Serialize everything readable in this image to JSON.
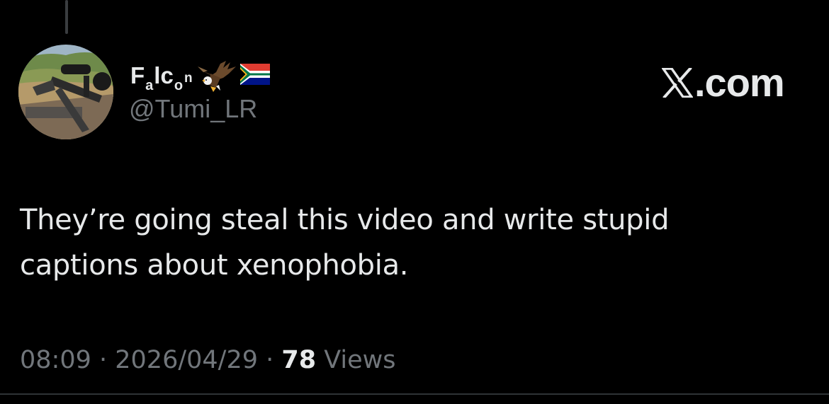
{
  "author": {
    "display_name": {
      "F": "F",
      "a": "a",
      "l": "l",
      "c": "c",
      "o": "o",
      "n": "n"
    },
    "name_emojis": [
      "eagle-icon",
      "south-africa-flag-icon"
    ],
    "handle": "@Tumi_LR",
    "avatar": "avatar-rifle-scope-landscape"
  },
  "brand": {
    "icon": "x-logo-icon",
    "label": ".com"
  },
  "tweet": {
    "text": "They’re going steal this video and write stupid\ncaptions about xenophobia."
  },
  "meta": {
    "time": "08:09",
    "separator": " · ",
    "date": "2026/04/29",
    "views_count": "78",
    "views_label": " Views"
  },
  "colors": {
    "background": "#000000",
    "primary_text": "#e7e9ea",
    "secondary_text": "#71767b",
    "divider": "#2f3336"
  }
}
